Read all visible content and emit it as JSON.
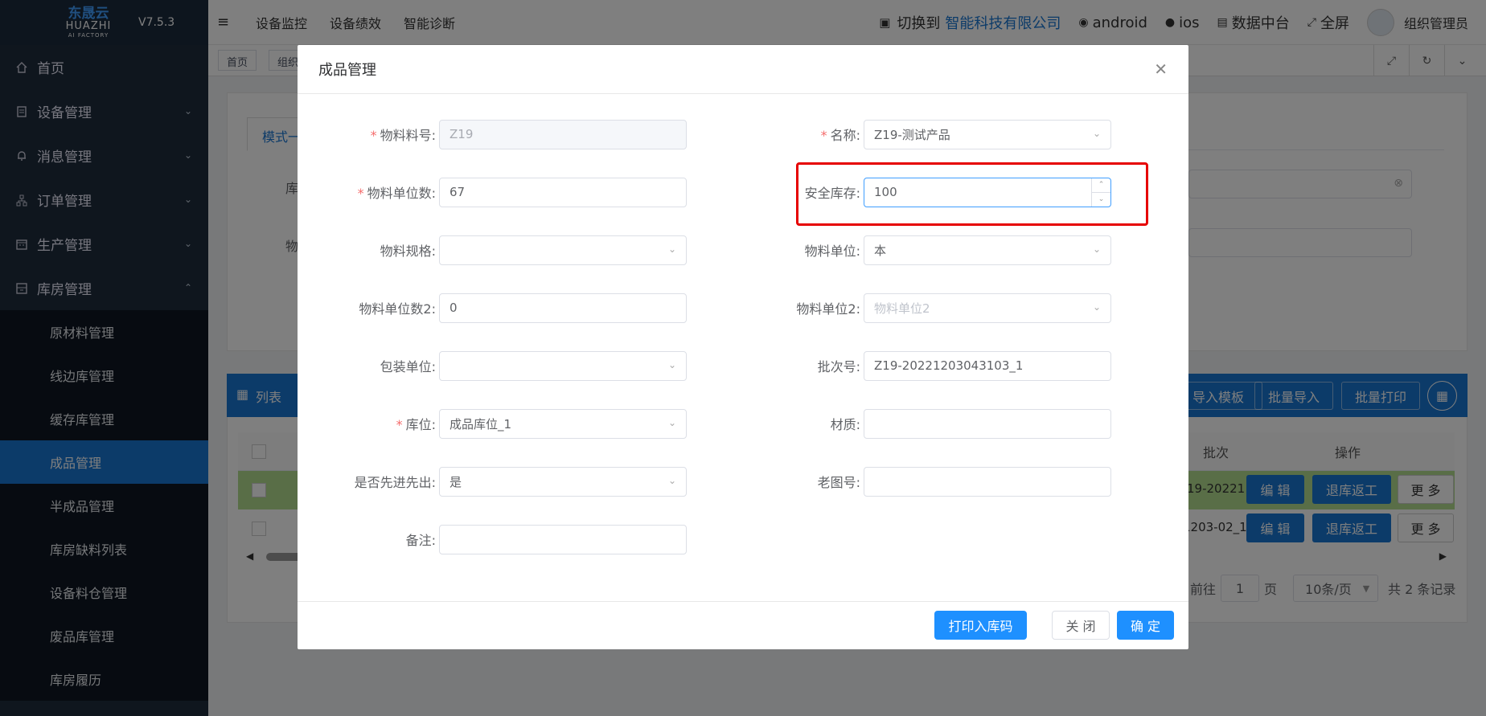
{
  "app": {
    "brand_cn": "东晟云",
    "brand_en": "HUAZHI",
    "brand_sub": "AI FACTORY",
    "version": "V7.5.3"
  },
  "sidebar": {
    "items": [
      {
        "label": "首页",
        "icon": "home-icon"
      },
      {
        "label": "设备管理",
        "icon": "monitor-icon"
      },
      {
        "label": "消息管理",
        "icon": "bell-icon"
      },
      {
        "label": "订单管理",
        "icon": "sitemap-icon"
      },
      {
        "label": "生产管理",
        "icon": "calendar-icon"
      },
      {
        "label": "库房管理",
        "icon": "warehouse-icon"
      }
    ],
    "sub_items": [
      "原材料管理",
      "线边库管理",
      "缓存库管理",
      "成品管理",
      "半成品管理",
      "库房缺料列表",
      "设备料仓管理",
      "废品库管理",
      "库房履历"
    ]
  },
  "topbar": {
    "nav": [
      "设备监控",
      "设备绩效",
      "智能诊断"
    ],
    "switch_label": "切换到",
    "company": "智能科技有限公司",
    "android": "android",
    "ios": "ios",
    "datacenter": "数据中台",
    "fullscreen": "全屏",
    "user": "组织管理员"
  },
  "tags": {
    "home": "首页",
    "org": "组织"
  },
  "background": {
    "tab": "模式一",
    "label_ku": "库",
    "label_wu": "物",
    "list_title": "列表",
    "btn_template": "导入模板",
    "btn_import": "批量导入",
    "btn_print": "批量打印",
    "col_batch": "批次",
    "col_action": "操作",
    "rows": [
      {
        "batch": "19-20221",
        "edit": "编 辑",
        "return": "退库返工",
        "more": "更 多"
      },
      {
        "batch": "1203-02_1",
        "edit": "编 辑",
        "return": "退库返工",
        "more": "更 多"
      }
    ],
    "pagination": {
      "goto": "前往",
      "page": "1",
      "page_unit": "页",
      "size": "10条/页",
      "total": "共 2 条记录"
    }
  },
  "dialog": {
    "title": "成品管理",
    "fields": {
      "code": {
        "label": "物料料号:",
        "value": "Z19"
      },
      "name": {
        "label": "名称:",
        "value": "Z19-测试产品"
      },
      "unit_count": {
        "label": "物料单位数:",
        "value": "67"
      },
      "safety_stock": {
        "label": "安全库存:",
        "value": "100"
      },
      "spec": {
        "label": "物料规格:",
        "value": ""
      },
      "unit": {
        "label": "物料单位:",
        "value": "本"
      },
      "unit_count2": {
        "label": "物料单位数2:",
        "value": "0"
      },
      "unit2": {
        "label": "物料单位2:",
        "placeholder": "物料单位2"
      },
      "pack_unit": {
        "label": "包装单位:",
        "value": ""
      },
      "batch": {
        "label": "批次号:",
        "value": "Z19-20221203043103_1"
      },
      "location": {
        "label": "库位:",
        "value": "成品库位_1"
      },
      "material": {
        "label": "材质:",
        "value": ""
      },
      "fifo": {
        "label": "是否先进先出:",
        "value": "是"
      },
      "old_drawing": {
        "label": "老图号:",
        "value": ""
      },
      "remark": {
        "label": "备注:",
        "value": ""
      }
    },
    "buttons": {
      "print": "打印入库码",
      "close": "关 闭",
      "confirm": "确 定"
    }
  },
  "colors": {
    "primary": "#1976d2",
    "highlight": "#e60000",
    "sidebar": "#1f2d3d"
  }
}
